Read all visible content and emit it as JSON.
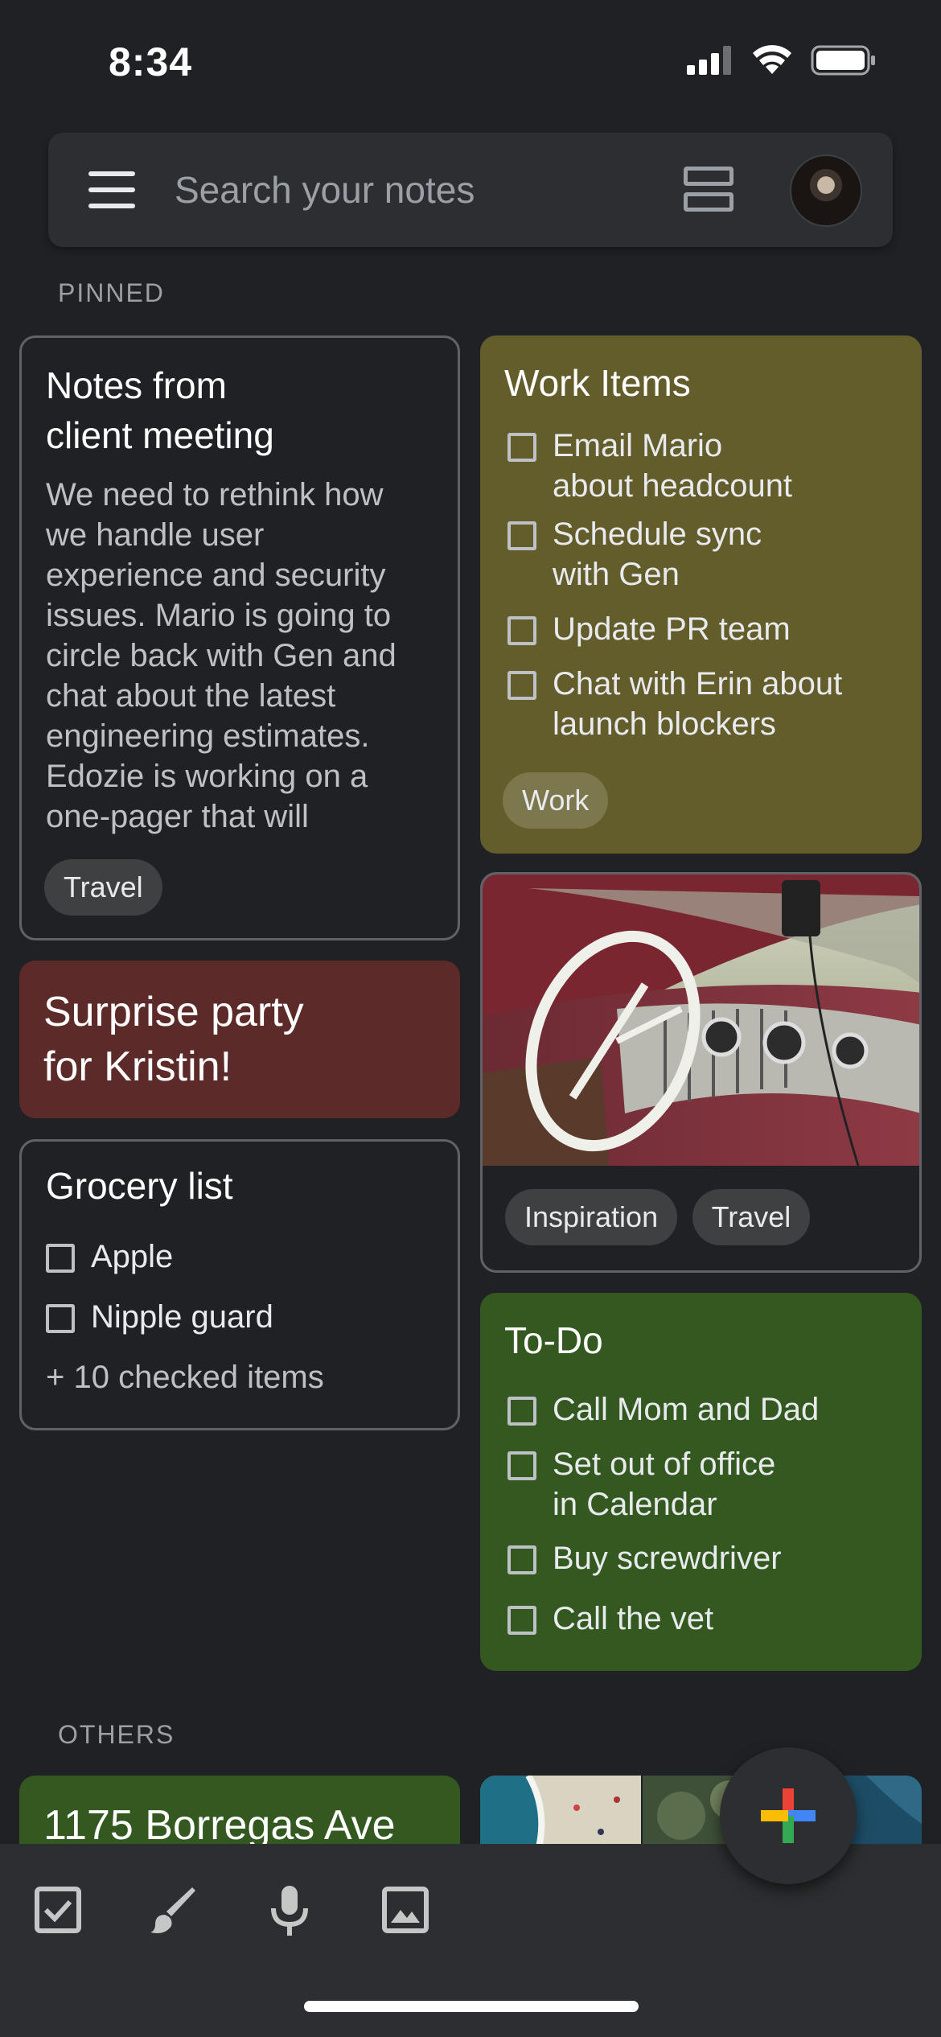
{
  "status_bar": {
    "time": "8:34"
  },
  "search": {
    "placeholder": "Search your notes"
  },
  "sections": {
    "pinned": "PINNED",
    "others": "OTHERS"
  },
  "notes": {
    "client_meeting": {
      "title_line1": "Notes from",
      "title_line2": "client meeting",
      "body": [
        "We need to rethink how",
        "we handle user",
        "experience and security",
        "issues. Mario is going to",
        "circle back with Gen and",
        "chat about the latest",
        "engineering estimates.",
        "Edozie is working on a",
        "one-pager that will"
      ],
      "label": "Travel"
    },
    "surprise_party": {
      "title_line1": "Surprise party",
      "title_line2": "for Kristin!"
    },
    "grocery": {
      "title": "Grocery list",
      "items": [
        "Apple",
        "Nipple guard"
      ],
      "checked_summary": "+ 10 checked items"
    },
    "work_items": {
      "title": "Work Items",
      "items": [
        [
          "Email Mario",
          "about headcount"
        ],
        [
          "Schedule sync",
          "with Gen"
        ],
        [
          "Update PR team"
        ],
        [
          "Chat with Erin about",
          "launch blockers"
        ]
      ],
      "label": "Work"
    },
    "car_photo": {
      "labels": [
        "Inspiration",
        "Travel"
      ]
    },
    "todo": {
      "title": "To-Do",
      "items": [
        [
          "Call Mom and Dad"
        ],
        [
          "Set out of office",
          "in Calendar"
        ],
        [
          "Buy screwdriver"
        ],
        [
          "Call the vet"
        ]
      ]
    },
    "address": {
      "title": "1175 Borregas Ave"
    }
  },
  "bottom_bar": {
    "icons": [
      "checkbox-icon",
      "brush-icon",
      "mic-icon",
      "image-icon"
    ]
  },
  "fab": {
    "icon": "plus-icon"
  },
  "colors": {
    "background": "#202124",
    "work_card": "#635d2c",
    "party_card": "#5c2b29",
    "todo_card": "#345920",
    "address_card": "#345920"
  }
}
